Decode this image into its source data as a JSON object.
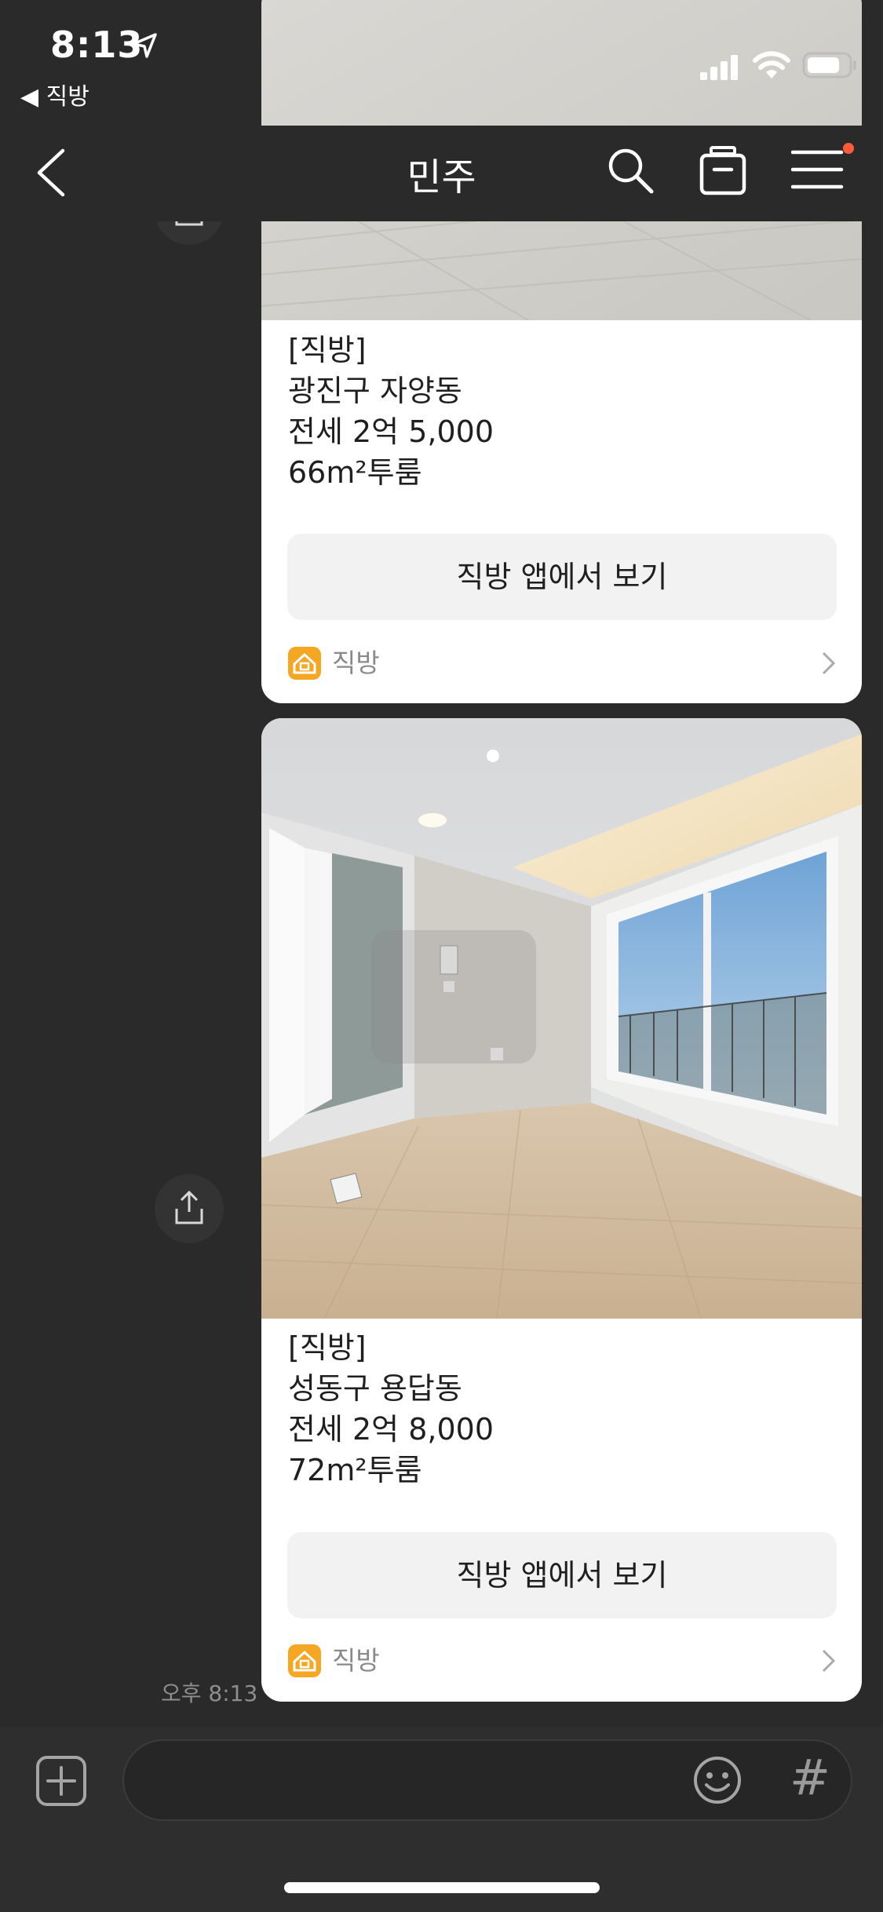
{
  "status_bar": {
    "time": "8:13",
    "back_app_label": "◀ 직방"
  },
  "header": {
    "title": "민주"
  },
  "messages": [
    {
      "source": "[직방]",
      "location": "광진구 자양동",
      "price": "전세 2억 5,000",
      "area": "66m²투룸",
      "button_label": "직방 앱에서 보기",
      "app_name": "직방"
    },
    {
      "source": "[직방]",
      "location": "성동구 용답동",
      "price": "전세 2억 8,000",
      "area": "72m²투룸",
      "button_label": "직방 앱에서 보기",
      "app_name": "직방"
    }
  ],
  "timestamp": "오후 8:13",
  "input": {
    "hash_label": "#"
  },
  "colors": {
    "background": "#2a2a2a",
    "card": "#ffffff",
    "app_logo": "#f5a623",
    "notification_dot": "#ff5b3a"
  }
}
